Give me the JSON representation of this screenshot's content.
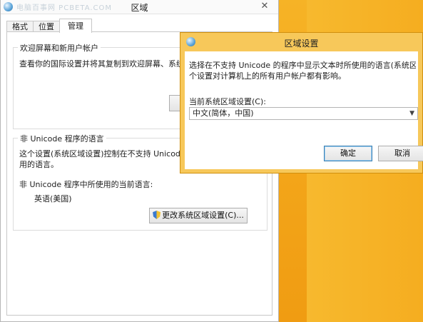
{
  "watermark": "电脑百事网 PCBETA.COM",
  "window": {
    "title": "区域",
    "close": "✕"
  },
  "tabs": [
    {
      "label": "格式"
    },
    {
      "label": "位置"
    },
    {
      "label": "管理"
    }
  ],
  "welcome_group": {
    "title": "欢迎屏幕和新用户帐户",
    "description": "查看你的国际设置并将其复制到欢迎屏幕、系统帐户"
  },
  "unicode_group": {
    "title": "非 Unicode 程序的语言",
    "description_line1": "这个设置(系统区域设置)控制在不支持 Unicode 的程",
    "description_line2": "用的语言。",
    "current_label": "非 Unicode 程序中所使用的当前语言:",
    "current_value": "英语(美国)",
    "change_button": "更改系统区域设置(C)..."
  },
  "dialog": {
    "title": "区域设置",
    "description_line1": "选择在不支持 Unicode 的程序中显示文本时所使用的语言(系统区域设置)。这",
    "description_line2": "个设置对计算机上的所有用户帐户都有影响。",
    "locale_label": "当前系统区域设置(C):",
    "locale_value": "中文(简体，中国)",
    "ok_button": "确定",
    "cancel_button": "取消"
  }
}
